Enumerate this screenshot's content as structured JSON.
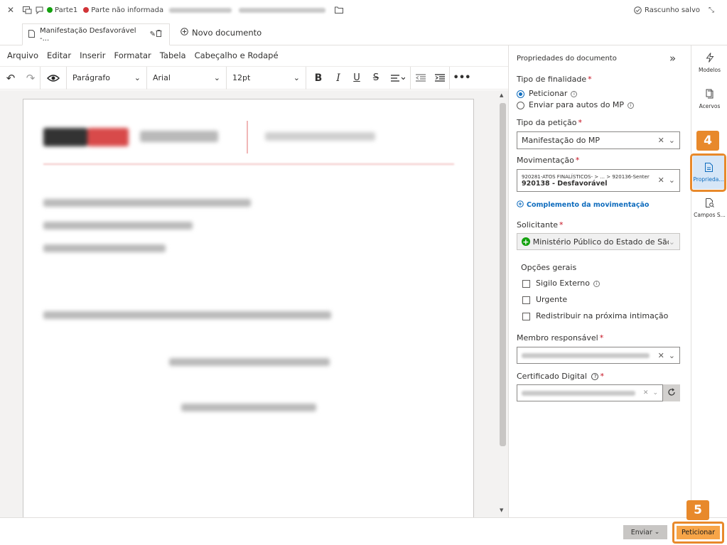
{
  "topbar": {
    "party1": "Parte1",
    "party2": "Parte não informada",
    "saved": "Rascunho salvo",
    "color_party1": "#13a10e",
    "color_party2": "#d13438"
  },
  "tabs": {
    "doc_tab": "Manifestação Desfavorável -...",
    "new_doc": "Novo documento"
  },
  "menu": [
    "Arquivo",
    "Editar",
    "Inserir",
    "Formatar",
    "Tabela",
    "Cabeçalho e Rodapé"
  ],
  "toolbar": {
    "style": "Parágrafo",
    "font": "Arial",
    "size": "12pt"
  },
  "panel": {
    "title": "Propriedades do documento",
    "finalidade_label": "Tipo de finalidade",
    "opt_peticionar": "Peticionar",
    "opt_enviar": "Enviar para autos do MP",
    "tipo_peticao_label": "Tipo da petição",
    "tipo_peticao_value": "Manifestação do MP",
    "movimentacao_label": "Movimentação",
    "mov_path": "920281-ATOS FINALÍSTICOS- > ... > 920136-Senter",
    "mov_value": "920138 - Desfavorável",
    "complemento": "Complemento da movimentação",
    "solicitante_label": "Solicitante",
    "solicitante_value": "Ministério Público do Estado de São",
    "opcoes_label": "Opções gerais",
    "opt_sigilo": "Sigilo Externo",
    "opt_urgente": "Urgente",
    "opt_redistribuir": "Redistribuir na próxima intimação",
    "membro_label": "Membro responsável",
    "certificado_label": "Certificado Digital"
  },
  "rail": {
    "modelos": "Modelos",
    "acervos": "Acervos",
    "propriedades": "Proprieda...",
    "campos": "Campos S..."
  },
  "bottom": {
    "enviar": "Enviar",
    "peticionar": "Peticionar"
  },
  "annotations": {
    "badge4": "4",
    "badge5": "5"
  },
  "colors": {
    "accent": "#0f6cbd",
    "highlight": "#e8892b",
    "petition_button": "#f7a548"
  }
}
